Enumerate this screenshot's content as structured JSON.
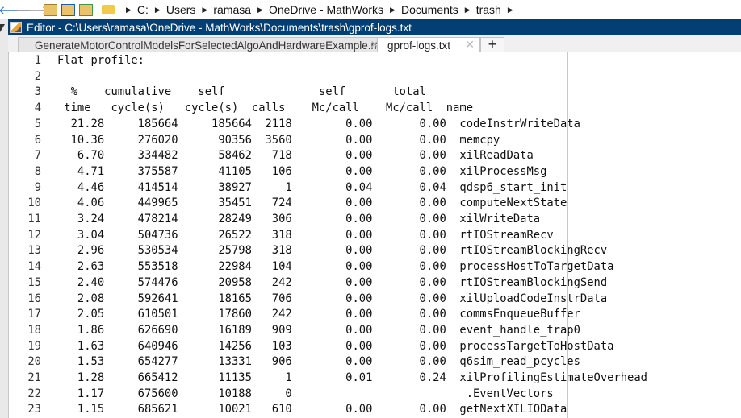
{
  "address_bar": {
    "crumbs": [
      "C:",
      "Users",
      "ramasa",
      "OneDrive - MathWorks",
      "Documents",
      "trash"
    ]
  },
  "window": {
    "title": "Editor - C:\\Users\\ramasa\\OneDrive - MathWorks\\Documents\\trash\\gprof-logs.txt"
  },
  "tabs": [
    {
      "label": "GenerateMotorControlModelsForSelectedAlgoAndHardwareExample.mlx",
      "active": false
    },
    {
      "label": "gprof-logs.txt",
      "active": true
    }
  ],
  "tab_close_glyph": "✕",
  "tab_add_glyph": "+",
  "editor": {
    "lines": [
      "Flat profile:",
      "",
      "  %    cumulative    self              self       total",
      " time   cycle(s)   cycle(s)  calls    Mc/call    Mc/call  name",
      "  21.28     185664     185664  2118        0.00       0.00  codeInstrWriteData",
      "  10.36     276020      90356  3560        0.00       0.00  memcpy",
      "   6.70     334482      58462   718        0.00       0.00  xilReadData",
      "   4.71     375587      41105   106        0.00       0.00  xilProcessMsg",
      "   4.46     414514      38927     1        0.04       0.04  qdsp6_start_init",
      "   4.06     449965      35451   724        0.00       0.00  computeNextState",
      "   3.24     478214      28249   306        0.00       0.00  xilWriteData",
      "   3.04     504736      26522   318        0.00       0.00  rtIOStreamRecv",
      "   2.96     530534      25798   318        0.00       0.00  rtIOStreamBlockingRecv",
      "   2.63     553518      22984   104        0.00       0.00  processHostToTargetData",
      "   2.40     574476      20958   242        0.00       0.00  rtIOStreamBlockingSend",
      "   2.08     592641      18165   706        0.00       0.00  xilUploadCodeInstrData",
      "   2.05     610501      17860   242        0.00       0.00  commsEnqueueBuffer",
      "   1.86     626690      16189   909        0.00       0.00  event_handle_trap0",
      "   1.63     640946      14256   103        0.00       0.00  processTargetToHostData",
      "   1.53     654277      13331   906        0.00       0.00  q6sim_read_pcycles",
      "   1.28     665412      11135     1        0.01       0.24  xilProfilingEstimateOverhead",
      "   1.17     675600      10188     0                          .EventVectors",
      "   1.15     685621      10021   610        0.00       0.00  getNextXILIOData"
    ]
  }
}
